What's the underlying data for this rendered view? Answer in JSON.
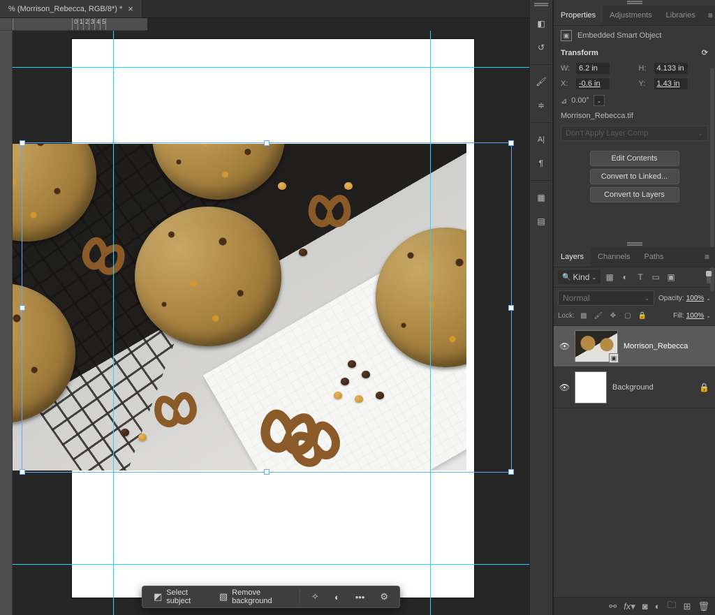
{
  "document": {
    "tab_title": "% (Morrison_Rebecca, RGB/8*) *",
    "ruler_ticks": [
      "0",
      "1",
      "2",
      "3",
      "4",
      "5"
    ]
  },
  "quick_actions": {
    "select_subject": "Select subject",
    "remove_background": "Remove background"
  },
  "collapsed_panels": {
    "icons": [
      "color-icon",
      "history-icon",
      "brush-icon",
      "adjust-icon",
      "character-icon",
      "paragraph-icon",
      "swatches-icon",
      "info-icon"
    ]
  },
  "properties": {
    "tabs": {
      "properties": "Properties",
      "adjustments": "Adjustments",
      "libraries": "Libraries"
    },
    "object_type": "Embedded Smart Object",
    "section_transform": "Transform",
    "w_label": "W:",
    "w_val": "6.2 in",
    "h_label": "H:",
    "h_val": "4.133 in",
    "x_label": "X:",
    "x_val": "-0.6 in",
    "y_label": "Y:",
    "y_val": "1.43 in",
    "angle": "0.00°",
    "linked_file": "Morrison_Rebecca.tif",
    "layer_comp": "Don't Apply Layer Comp",
    "btn_edit": "Edit Contents",
    "btn_convert_linked": "Convert to Linked...",
    "btn_convert_layers": "Convert to Layers"
  },
  "layers_panel": {
    "tabs": {
      "layers": "Layers",
      "channels": "Channels",
      "paths": "Paths"
    },
    "filter_kind": "Kind",
    "blend_mode": "Normal",
    "opacity_label": "Opacity:",
    "opacity_value": "100%",
    "lock_label": "Lock:",
    "fill_label": "Fill:",
    "fill_value": "100%",
    "layers": [
      {
        "name": "Morrison_Rebecca",
        "selected": true,
        "smart": true
      },
      {
        "name": "Background",
        "locked": true
      }
    ]
  }
}
